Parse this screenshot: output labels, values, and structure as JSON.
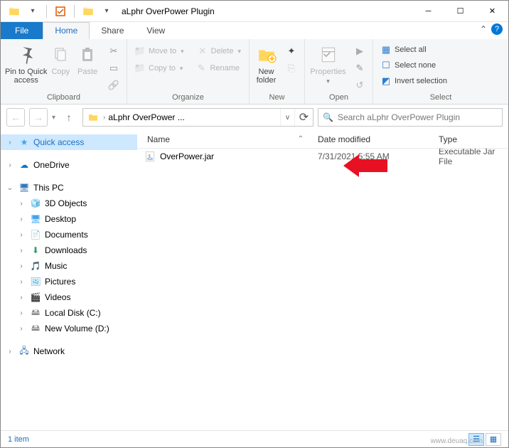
{
  "window": {
    "title": "aLphr OverPower Plugin"
  },
  "tabs": {
    "file": "File",
    "home": "Home",
    "share": "Share",
    "view": "View"
  },
  "ribbon": {
    "clipboard": {
      "label": "Clipboard",
      "pin": "Pin to Quick\naccess",
      "copy": "Copy",
      "paste": "Paste"
    },
    "organize": {
      "label": "Organize",
      "moveto": "Move to",
      "copyto": "Copy to",
      "delete": "Delete",
      "rename": "Rename"
    },
    "new": {
      "label": "New",
      "newfolder": "New\nfolder"
    },
    "open": {
      "label": "Open",
      "properties": "Properties"
    },
    "select": {
      "label": "Select",
      "all": "Select all",
      "none": "Select none",
      "invert": "Invert selection"
    }
  },
  "address": {
    "crumb": "aLphr OverPower ..."
  },
  "search": {
    "placeholder": "Search aLphr OverPower Plugin"
  },
  "columns": {
    "name": "Name",
    "date": "Date modified",
    "type": "Type"
  },
  "files": [
    {
      "name": "OverPower.jar",
      "date": "7/31/2021 5:55 AM",
      "type": "Executable Jar File"
    }
  ],
  "nav": {
    "quick": "Quick access",
    "onedrive": "OneDrive",
    "thispc": "This PC",
    "items": [
      "3D Objects",
      "Desktop",
      "Documents",
      "Downloads",
      "Music",
      "Pictures",
      "Videos",
      "Local Disk (C:)",
      "New Volume (D:)"
    ],
    "network": "Network"
  },
  "status": {
    "count": "1 item"
  },
  "watermark": "www.deuaq.com"
}
